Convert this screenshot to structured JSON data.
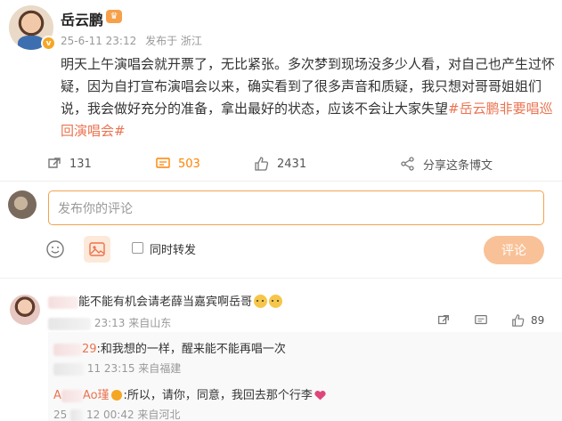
{
  "post": {
    "username": "岳云鹏",
    "date": "25-6-11 23:12",
    "published_from": "发布于 浙江",
    "body_text": "明天上午演唱会就开票了，无比紧张。多次梦到现场没多少人看，对自己也产生过怀疑，因为自打宣布演唱会以来，确实看到了很多声音和质疑，我只想对哥哥姐姐们说，我会做好充分的准备，拿出最好的状态，应该不会让大家失望",
    "hashtag": "#岳云鹏非要唱巡回演唱会#",
    "icons": {
      "crown": "crown-icon",
      "verified": "verified-badge-icon"
    }
  },
  "actions": {
    "repost_count": "131",
    "comment_count": "503",
    "like_count": "2431",
    "share_label": "分享这条博文"
  },
  "composer": {
    "placeholder": "发布你的评论",
    "repost_label": "同时转发",
    "submit_label": "评论"
  },
  "comments": [
    {
      "text": "能不能有机会请老薛当嘉宾啊岳哥",
      "time": "23:13 来自山东",
      "reply_count": "",
      "like_count": "89",
      "replies": [
        {
          "user_suffix": "29",
          "text": ":和我想的一样，醒来能不能再唱一次",
          "time": "11 23:15 来自福建"
        },
        {
          "user_prefix": "A",
          "user_suffix": "Ao瑾",
          "text": ":所以，请你，同意，我回去那个行李",
          "time_prefix": "25",
          "time": "12 00:42 来自河北"
        }
      ]
    }
  ],
  "colors": {
    "accent_orange": "#ff8200",
    "link": "#eb7350",
    "submit_bg": "#f9c197",
    "input_border": "#f3a24e"
  }
}
